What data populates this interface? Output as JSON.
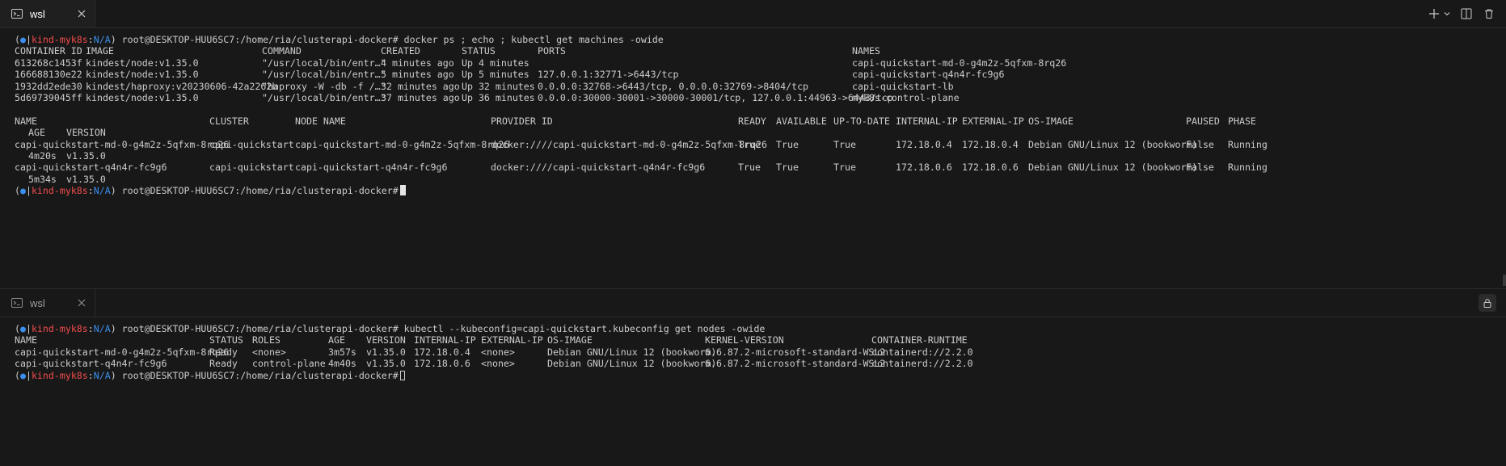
{
  "prompt": {
    "open": "(",
    "dot": "●",
    "bar": "|",
    "context": "kind-myk8s",
    "colon": ":",
    "namespace": "N/A",
    "close": ")",
    "user_path": " root@DESKTOP-HUU6SC7:/home/ria/clusterapi-docker#"
  },
  "top_pane": {
    "tab_label": "wsl",
    "command": " docker ps ; echo ; kubectl get machines -owide",
    "docker_headers": [
      "CONTAINER ID",
      "IMAGE",
      "COMMAND",
      "CREATED",
      "STATUS",
      "PORTS",
      "NAMES"
    ],
    "docker_rows": [
      [
        "613268c1453f",
        "kindest/node:v1.35.0",
        "\"/usr/local/bin/entr…\"",
        "4 minutes ago",
        "Up 4 minutes",
        "",
        "capi-quickstart-md-0-g4m2z-5qfxm-8rq26"
      ],
      [
        "166688130e22",
        "kindest/node:v1.35.0",
        "\"/usr/local/bin/entr…\"",
        "5 minutes ago",
        "Up 5 minutes",
        "127.0.0.1:32771->6443/tcp",
        "capi-quickstart-q4n4r-fc9g6"
      ],
      [
        "1932dd2ede30",
        "kindest/haproxy:v20230606-42a2262b",
        "\"haproxy -W -db -f /…\"",
        "32 minutes ago",
        "Up 32 minutes",
        "0.0.0.0:32768->6443/tcp, 0.0.0.0:32769->8404/tcp",
        "capi-quickstart-lb"
      ],
      [
        "5d69739045ff",
        "kindest/node:v1.35.0",
        "\"/usr/local/bin/entr…\"",
        "37 minutes ago",
        "Up 36 minutes",
        "0.0.0.0:30000-30001->30000-30001/tcp, 127.0.0.1:44963->6443/tcp",
        "myk8s-control-plane"
      ]
    ],
    "machine_headers": [
      "NAME",
      "CLUSTER",
      "NODE NAME",
      "PROVIDER ID",
      "READY",
      "AVAILABLE",
      "UP-TO-DATE",
      "INTERNAL-IP",
      "EXTERNAL-IP",
      "OS-IMAGE",
      "PAUSED",
      "PHASE"
    ],
    "machine_headers_wrap": [
      "AGE",
      "VERSION"
    ],
    "machine_rows": [
      {
        "cols": [
          "capi-quickstart-md-0-g4m2z-5qfxm-8rq26",
          "capi-quickstart",
          "capi-quickstart-md-0-g4m2z-5qfxm-8rq26",
          "docker:////capi-quickstart-md-0-g4m2z-5qfxm-8rq26",
          "True",
          "True",
          "True",
          "172.18.0.4",
          "172.18.0.4",
          "Debian GNU/Linux 12 (bookworm)",
          "False",
          "Running"
        ],
        "wrap": [
          "4m20s",
          "v1.35.0"
        ]
      },
      {
        "cols": [
          "capi-quickstart-q4n4r-fc9g6",
          "capi-quickstart",
          "capi-quickstart-q4n4r-fc9g6",
          "docker:////capi-quickstart-q4n4r-fc9g6",
          "True",
          "True",
          "True",
          "172.18.0.6",
          "172.18.0.6",
          "Debian GNU/Linux 12 (bookworm)",
          "False",
          "Running"
        ],
        "wrap": [
          "5m34s",
          "v1.35.0"
        ]
      }
    ]
  },
  "bottom_pane": {
    "tab_label": "wsl",
    "command": " kubectl --kubeconfig=capi-quickstart.kubeconfig get nodes -owide",
    "node_headers": [
      "NAME",
      "STATUS",
      "ROLES",
      "AGE",
      "VERSION",
      "INTERNAL-IP",
      "EXTERNAL-IP",
      "OS-IMAGE",
      "KERNEL-VERSION",
      "CONTAINER-RUNTIME"
    ],
    "node_rows": [
      [
        "capi-quickstart-md-0-g4m2z-5qfxm-8rq26",
        "Ready",
        "<none>",
        "3m57s",
        "v1.35.0",
        "172.18.0.4",
        "<none>",
        "Debian GNU/Linux 12 (bookworm)",
        "6.6.87.2-microsoft-standard-WSL2",
        "containerd://2.2.0"
      ],
      [
        "capi-quickstart-q4n4r-fc9g6",
        "Ready",
        "control-plane",
        "4m40s",
        "v1.35.0",
        "172.18.0.6",
        "<none>",
        "Debian GNU/Linux 12 (bookworm)",
        "6.6.87.2-microsoft-standard-WSL2",
        "containerd://2.2.0"
      ]
    ]
  },
  "icons": {
    "tab": "terminal-icon",
    "close": "close-icon",
    "add": "plus-icon",
    "dropdown": "chevron-down-icon",
    "split": "split-editor-icon",
    "trash": "trash-icon",
    "lock": "lock-icon"
  },
  "colors": {
    "background": "#181818",
    "text": "#cccccc",
    "prompt_context": "#f14c4c",
    "prompt_namespace": "#3b8eea"
  }
}
